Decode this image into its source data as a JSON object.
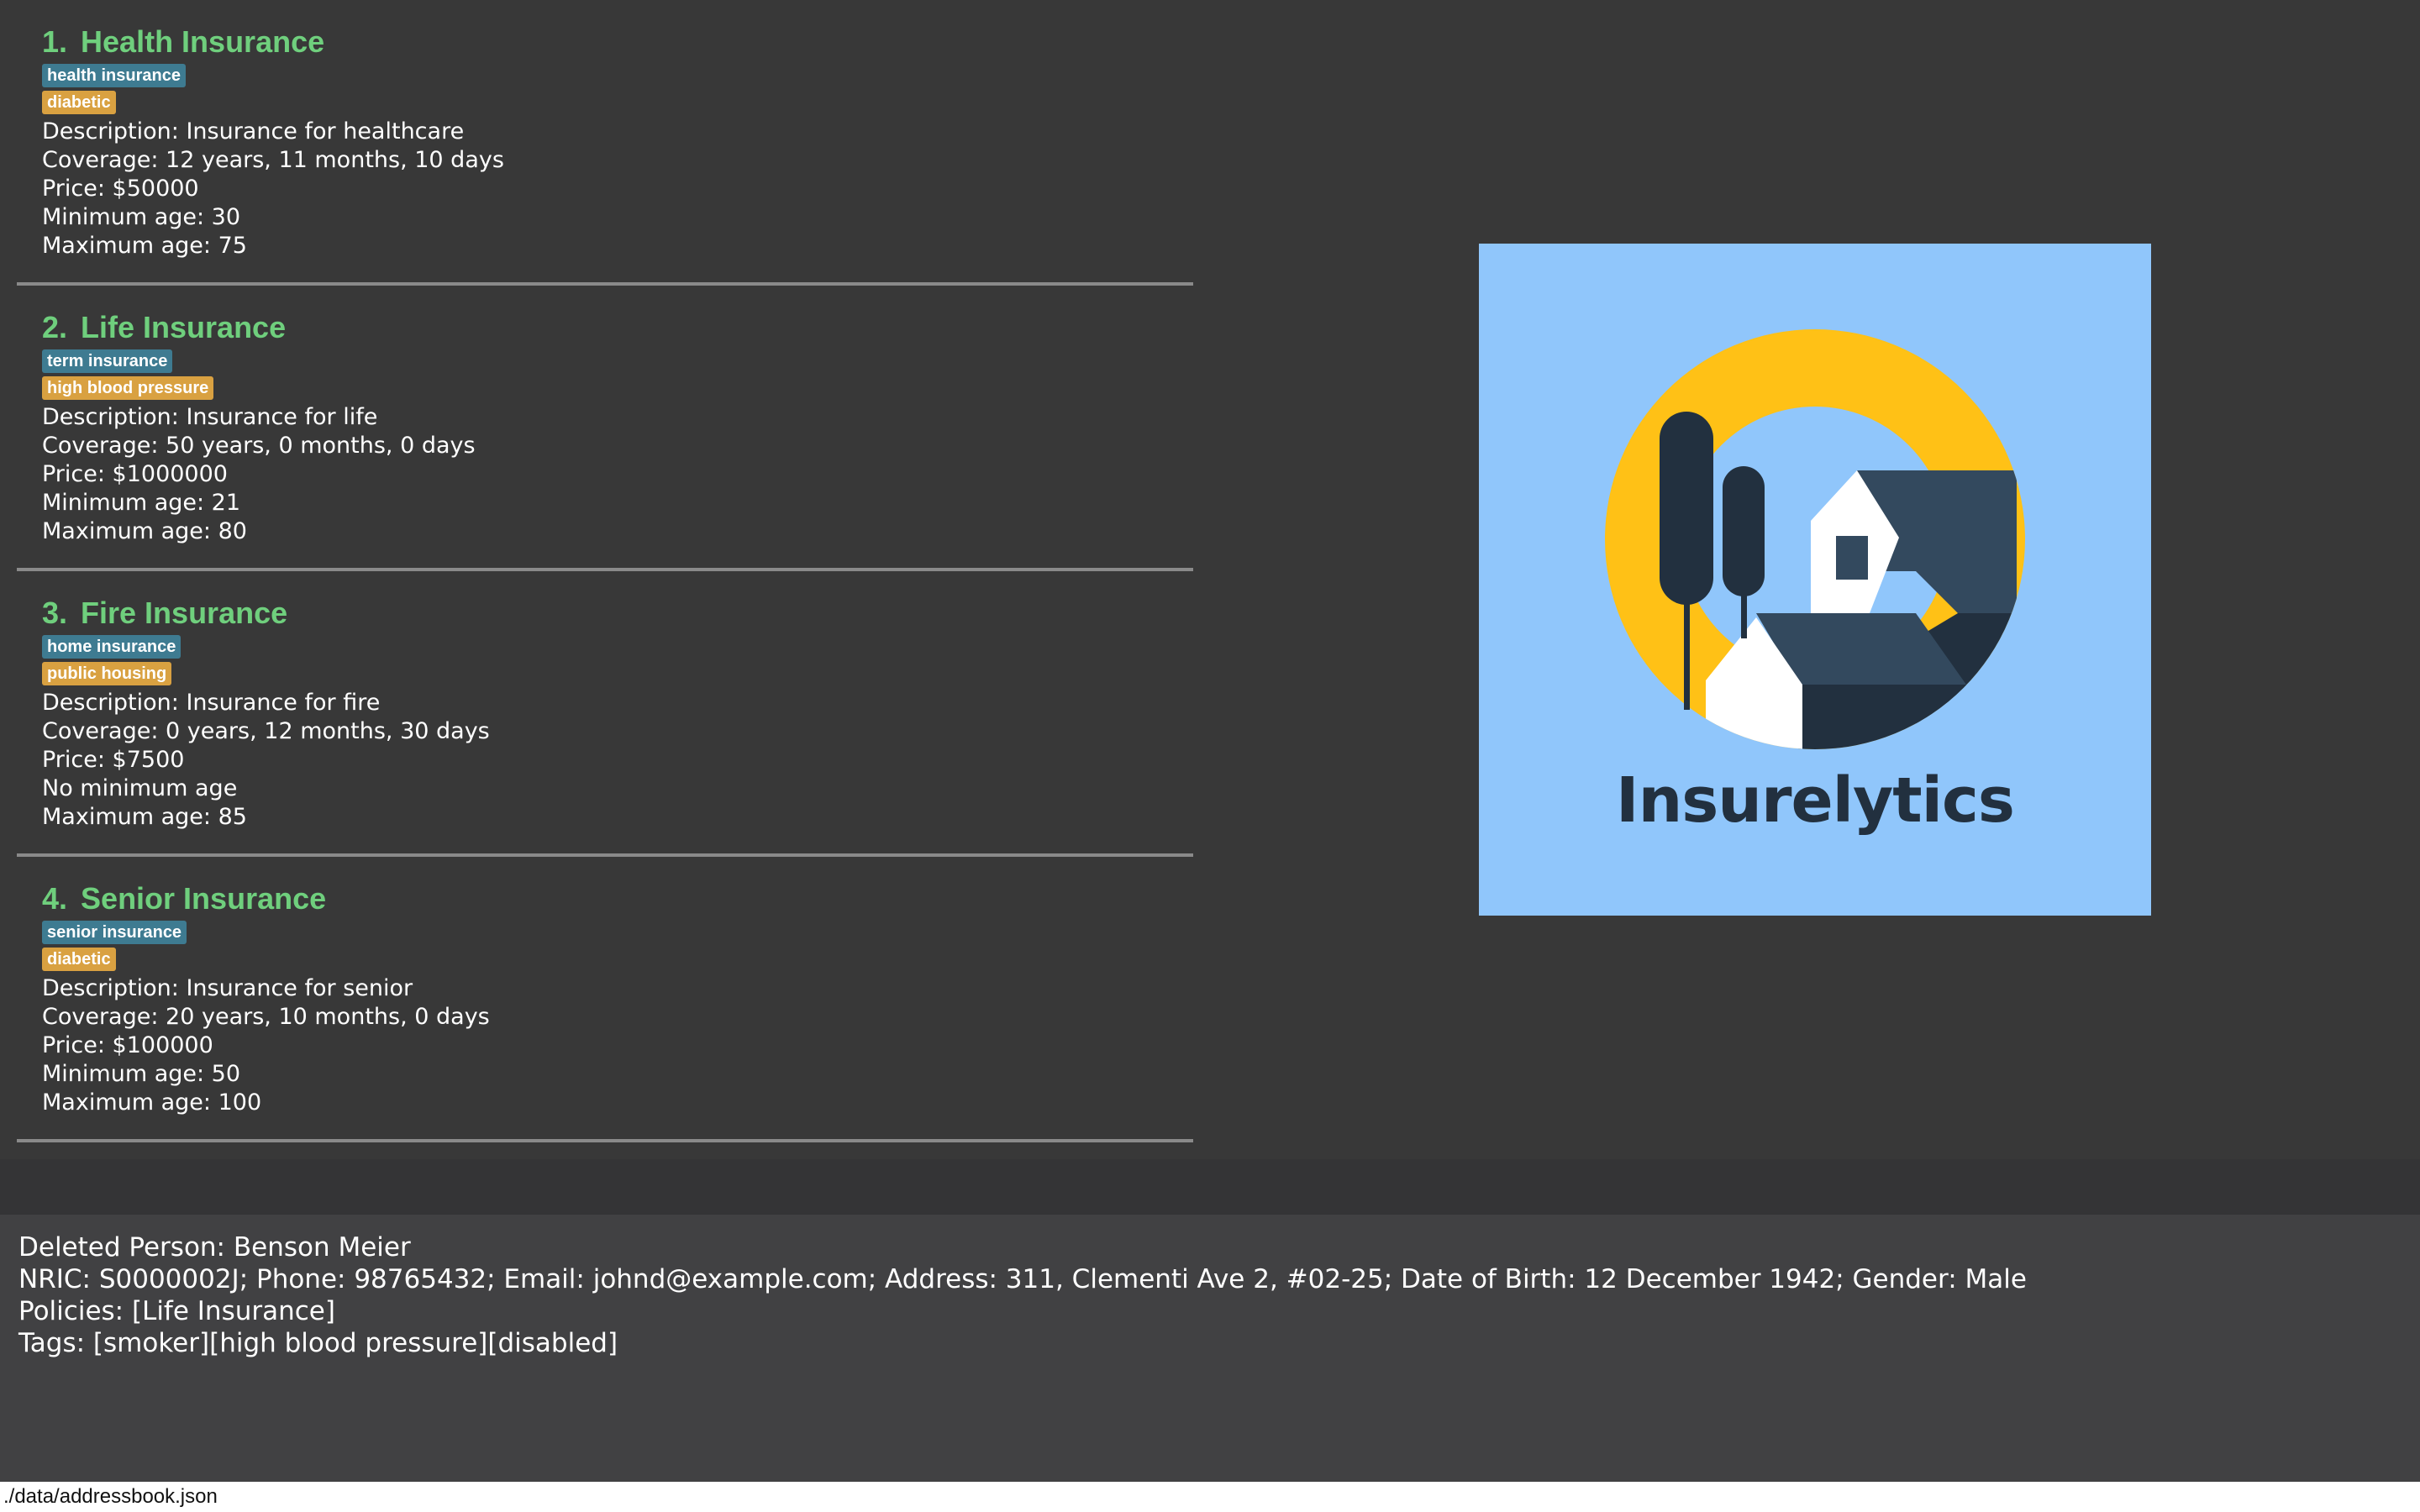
{
  "policies": [
    {
      "index": "1.",
      "name": "Health Insurance",
      "tags": [
        {
          "label": "health insurance",
          "color": "#3e7b91"
        },
        {
          "label": "diabetic",
          "color": "#d9a141"
        }
      ],
      "description": "Description: Insurance for healthcare",
      "coverage": "Coverage: 12 years, 11 months, 10 days",
      "price": "Price: $50000",
      "min_age": "Minimum age: 30",
      "max_age": "Maximum age: 75"
    },
    {
      "index": "2.",
      "name": "Life Insurance",
      "tags": [
        {
          "label": "term insurance",
          "color": "#3e7b91"
        },
        {
          "label": "high blood pressure",
          "color": "#d9a141"
        }
      ],
      "description": "Description: Insurance for life",
      "coverage": "Coverage: 50 years, 0 months, 0 days",
      "price": "Price: $1000000",
      "min_age": "Minimum age: 21",
      "max_age": "Maximum age: 80"
    },
    {
      "index": "3.",
      "name": "Fire Insurance",
      "tags": [
        {
          "label": "home insurance",
          "color": "#3e7b91"
        },
        {
          "label": "public housing",
          "color": "#d9a141"
        }
      ],
      "description": "Description: Insurance for fire",
      "coverage": "Coverage: 0 years, 12 months, 30 days",
      "price": "Price: $7500",
      "min_age": "No minimum age",
      "max_age": "Maximum age: 85"
    },
    {
      "index": "4.",
      "name": "Senior Insurance",
      "tags": [
        {
          "label": "senior insurance",
          "color": "#3e7b91"
        },
        {
          "label": "diabetic",
          "color": "#d9a141"
        }
      ],
      "description": "Description: Insurance for senior",
      "coverage": "Coverage: 20 years, 10 months, 0 days",
      "price": "Price: $100000",
      "min_age": "Minimum age: 50",
      "max_age": "Maximum age: 100"
    }
  ],
  "logo": {
    "text": "Insurelytics",
    "background": "#90c6fb",
    "ring_color": "#ffc116",
    "dark_color": "#22303f"
  },
  "result": {
    "line1": "Deleted Person: Benson Meier",
    "line2": "NRIC: S0000002J; Phone: 98765432; Email: johnd@example.com; Address: 311, Clementi Ave 2, #02-25; Date of Birth: 12 December 1942; Gender: Male",
    "line3": "Policies: [Life Insurance]",
    "line4": "Tags: [smoker][high blood pressure][disabled]"
  },
  "status_bar": {
    "path": "./data/addressbook.json"
  },
  "colors": {
    "title_green": "#6fcf7d",
    "tag_blue": "#3e7b91",
    "tag_orange": "#d9a141",
    "background": "#383838"
  }
}
